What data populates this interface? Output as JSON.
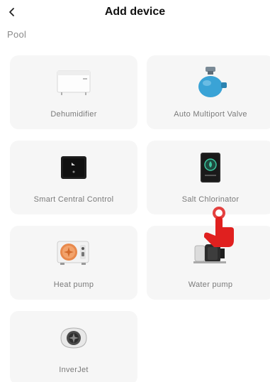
{
  "header": {
    "back_icon": "chevron-left-icon",
    "title": "Add device"
  },
  "section": {
    "label": "Pool"
  },
  "devices": [
    {
      "label": "Dehumidifier",
      "icon": "dehumidifier-icon"
    },
    {
      "label": "Auto Multiport Valve",
      "icon": "multiport-valve-icon"
    },
    {
      "label": "Smart Central Control",
      "icon": "central-control-icon"
    },
    {
      "label": "Salt Chlorinator",
      "icon": "salt-chlorinator-icon"
    },
    {
      "label": "Heat pump",
      "icon": "heat-pump-icon"
    },
    {
      "label": "Water pump",
      "icon": "water-pump-icon"
    },
    {
      "label": "InverJet",
      "icon": "inverjet-icon"
    }
  ],
  "colors": {
    "card_bg": "#f6f6f6",
    "label_text": "#7a7a7a",
    "accent_red": "#e0201f",
    "valve_blue": "#3aa3d6"
  }
}
